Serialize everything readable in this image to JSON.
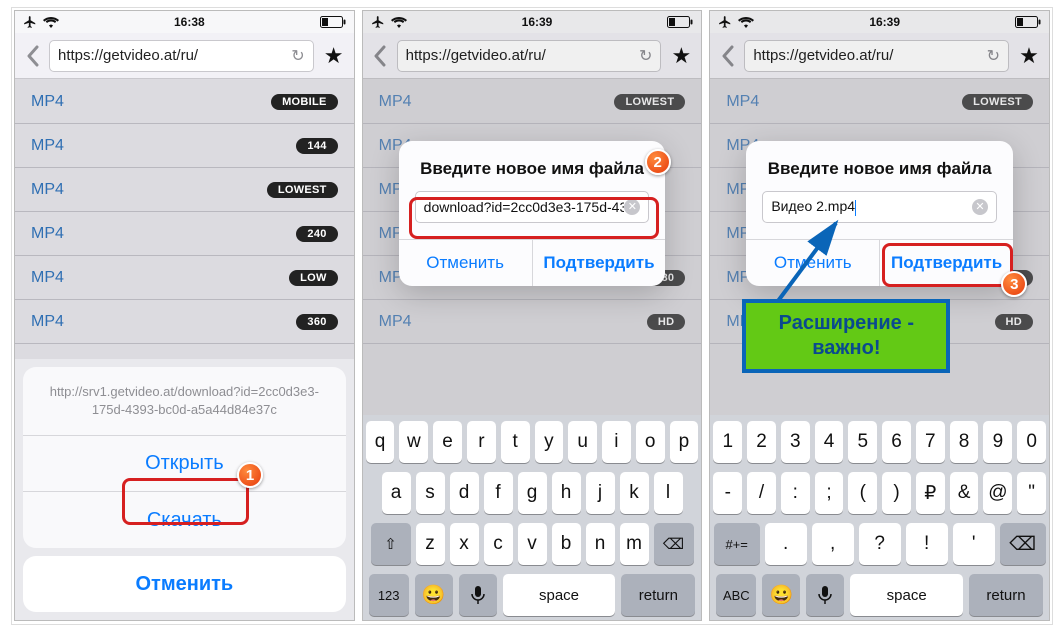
{
  "statusbar": {
    "time1": "16:38",
    "time2": "16:39",
    "time3": "16:39"
  },
  "navbar": {
    "url": "https://getvideo.at/ru/"
  },
  "phone1": {
    "rows": [
      {
        "label": "MP4",
        "badge": "MOBILE"
      },
      {
        "label": "MP4",
        "badge": "144"
      },
      {
        "label": "MP4",
        "badge": "LOWEST"
      },
      {
        "label": "MP4",
        "badge": "240"
      },
      {
        "label": "MP4",
        "badge": "LOW"
      },
      {
        "label": "MP4",
        "badge": "360"
      }
    ],
    "sheet": {
      "text": "http://srv1.getvideo.at/download?id=2cc0d3e3-175d-4393-bc0d-a5a44d84e37c",
      "open": "Открыть",
      "download": "Скачать",
      "cancel": "Отменить"
    }
  },
  "phone2": {
    "rows": [
      {
        "label": "MP4",
        "badge": "LOWEST"
      },
      {
        "label": "MP4",
        "badge": ""
      },
      {
        "label": "MP4",
        "badge": ""
      },
      {
        "label": "MP4",
        "badge": ""
      },
      {
        "label": "MP4",
        "badge": "480"
      },
      {
        "label": "MP4",
        "badge": "HD"
      }
    ],
    "dialog": {
      "title": "Введите новое имя файла",
      "value": "download?id=2cc0d3e3-175d-43",
      "cancel": "Отменить",
      "confirm": "Подтвердить"
    },
    "keys": {
      "r1": [
        "q",
        "w",
        "e",
        "r",
        "t",
        "y",
        "u",
        "i",
        "o",
        "p"
      ],
      "r2": [
        "a",
        "s",
        "d",
        "f",
        "g",
        "h",
        "j",
        "k",
        "l"
      ],
      "r3_shift": "⇧",
      "r3": [
        "z",
        "x",
        "c",
        "v",
        "b",
        "n",
        "m"
      ],
      "r3_del": "⌫",
      "r4_123": "123",
      "r4_emoji": "😀",
      "r4_mic": "🎤",
      "r4_space": "space",
      "r4_return": "return"
    }
  },
  "phone3": {
    "rows": [
      {
        "label": "MP4",
        "badge": "LOWEST"
      },
      {
        "label": "MP4",
        "badge": ""
      },
      {
        "label": "MP4",
        "badge": ""
      },
      {
        "label": "MP4",
        "badge": ""
      },
      {
        "label": "MP4",
        "badge": "480"
      },
      {
        "label": "MP4",
        "badge": "HD"
      }
    ],
    "dialog": {
      "title": "Введите новое имя файла",
      "value": "Видео 2.mp4",
      "cancel": "Отменить",
      "confirm": "Подтвердить"
    },
    "keys": {
      "r1": [
        "1",
        "2",
        "3",
        "4",
        "5",
        "6",
        "7",
        "8",
        "9",
        "0"
      ],
      "r2": [
        "-",
        "/",
        ":",
        ";",
        "(",
        ")",
        "₽",
        "&",
        "@",
        "\""
      ],
      "r3_shift": "#+=",
      "r3": [
        ".",
        ",",
        "?",
        "!",
        "'"
      ],
      "r3_del": "⌫",
      "r4_abc": "ABC",
      "r4_emoji": "😀",
      "r4_mic": "🎤",
      "r4_space": "space",
      "r4_return": "return"
    }
  },
  "markers": {
    "m1": "1",
    "m2": "2",
    "m3": "3"
  },
  "callout": {
    "line1": "Расширение -",
    "line2": "важно!"
  }
}
